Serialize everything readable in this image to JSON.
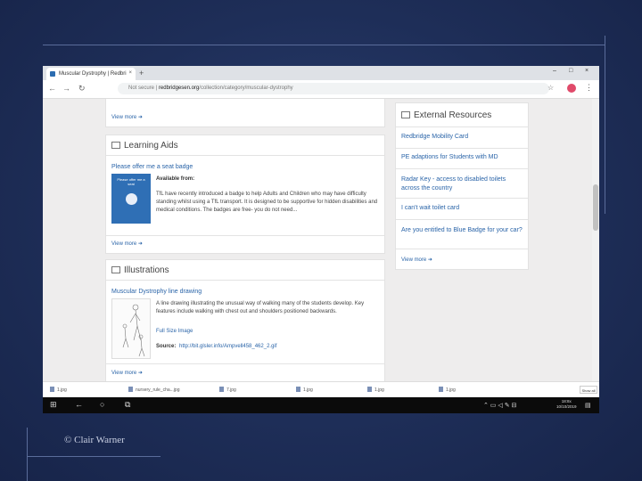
{
  "slide": {
    "credit": "© Clair Warner"
  },
  "browser": {
    "tab_title": "Muscular Dystrophy | Redbri",
    "tab_close": "×",
    "new_tab": "+",
    "win_min": "–",
    "win_max": "□",
    "win_close": "×",
    "back": "←",
    "forward": "→",
    "reload": "↻",
    "url_prefix": "Not secure | ",
    "url_domain": "redbridgesen.org",
    "url_path": "/collection/category/muscular-dystrophy",
    "menu": "⋮"
  },
  "page": {
    "top_view_more": "View more ➜",
    "learning": {
      "heading": "Learning Aids",
      "item_title": "Please offer me a seat badge",
      "available_from": "Available from:",
      "badge_caption": "Please offer me a seat",
      "desc": "TfL have recently introduced a badge to help Adults and Children who may have difficulty standing whilst using a TfL transport. It is designed to be supportive for hidden disabilities and medical conditions. The badges are free- you do not need...",
      "view_more": "View more ➜"
    },
    "illustrations": {
      "heading": "Illustrations",
      "item_title": "Muscular Dystrophy line drawing",
      "desc": "A line drawing illustrating the unusual way of walking many of the students develop. Key features include walking with chest out and shoulders positioned backwards.",
      "full_size": "Full Size Image",
      "source_label": "Source:",
      "source_url": "http://bit.glsler.info/Ampvell458_462_2.gif",
      "view_more": "View more ➜"
    },
    "external": {
      "heading": "External Resources",
      "links": [
        "Redbridge Mobility Card",
        "PE adaptions for Students with MD",
        "Radar Key - access to disabled toilets across the country",
        "I can't wait toilet card",
        "Are you entitled to Blue Badge for your car?"
      ],
      "view_more": "View more ➜"
    }
  },
  "downloads": {
    "items": [
      "1.jpg",
      "nursery_rule_cha...jpg",
      "7.jpg",
      "1.jpg",
      "1.jpg",
      "1.jpg"
    ],
    "show_all": "Show all"
  },
  "taskbar": {
    "time": "18:8x",
    "date": "10/10/2019"
  }
}
